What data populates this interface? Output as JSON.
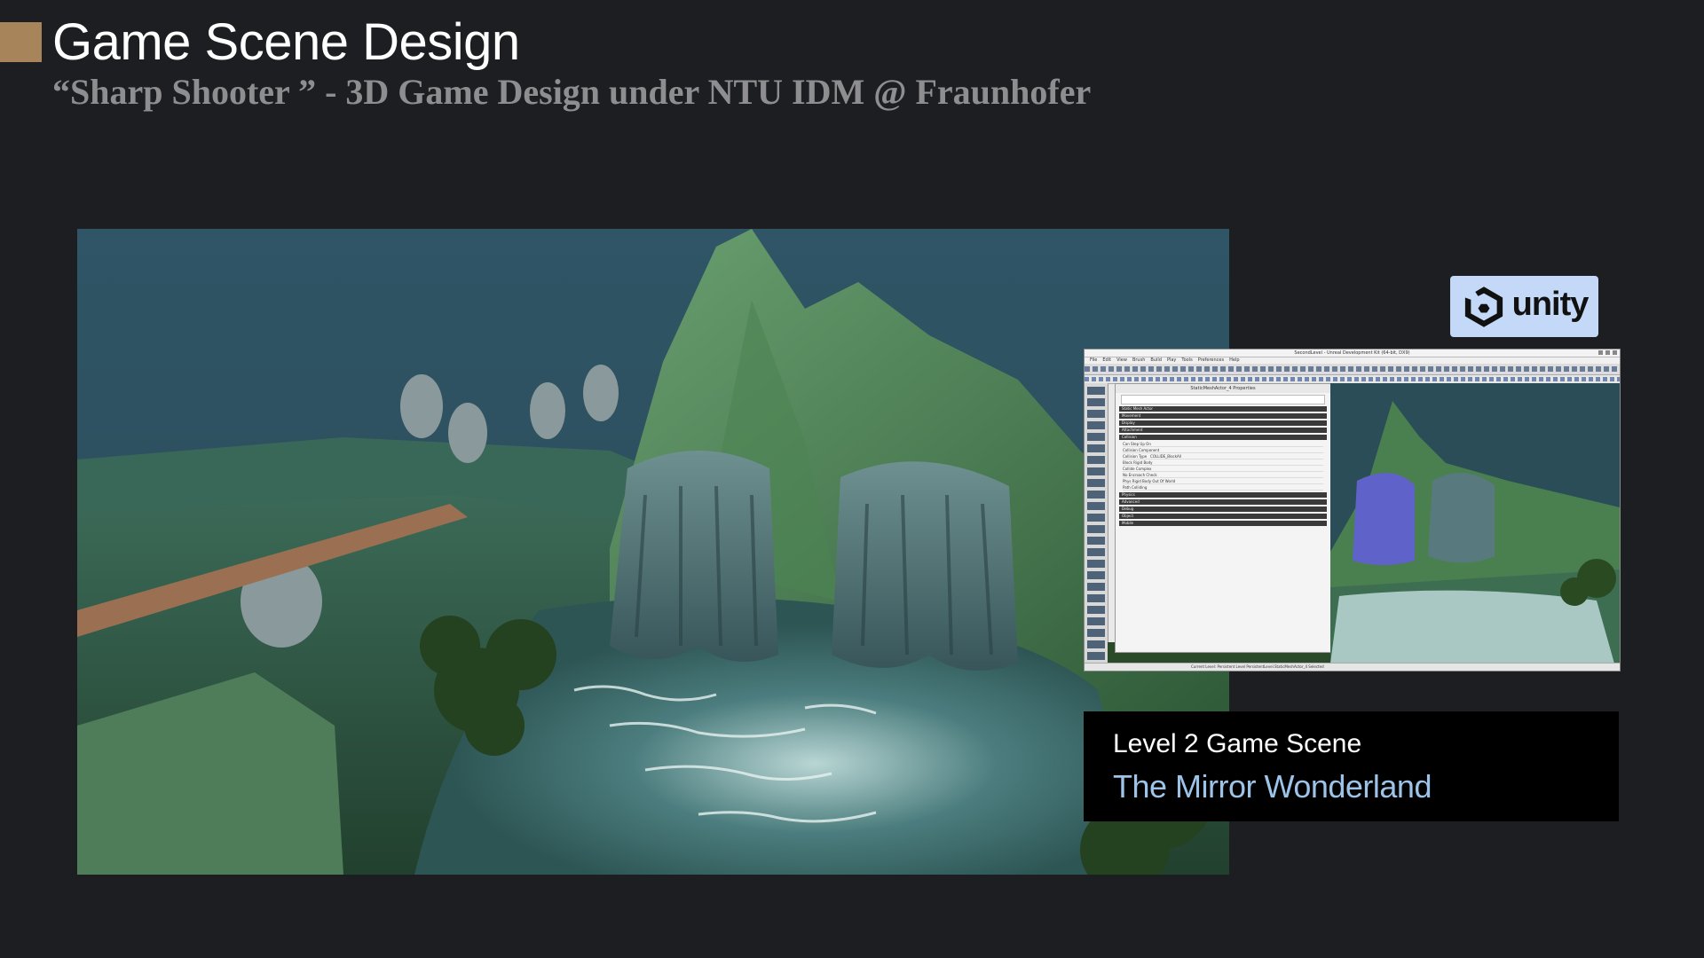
{
  "slide": {
    "title": "Game Scene Design",
    "subtitle": "“Sharp Shooter ” - 3D Game Design under NTU IDM @ Fraunhofer",
    "accent_color": "#a8845a",
    "background_color": "#1d1e22"
  },
  "main_image": {
    "icon": "game-scene-screenshot"
  },
  "badge": {
    "text": "unity",
    "icon": "unity-logo-icon",
    "background": "#c4d9f7"
  },
  "editor": {
    "window_title": "SecondLevel - Unreal Development Kit (64-bit, DX9)",
    "menu": [
      "File",
      "Edit",
      "View",
      "Brush",
      "Build",
      "Play",
      "Tools",
      "Preferences",
      "Help"
    ],
    "panel_title": "StaticMeshActor_4 Properties",
    "sections": [
      "Static Mesh Actor",
      "Movement",
      "Display",
      "Attachment",
      "Collision"
    ],
    "collision_rows": [
      "Can Step Up On",
      "Collision Component",
      "Collision Type",
      "Block Rigid Body",
      "Collide Complex",
      "No Encroach Check",
      "Phys Rigid Body Out Of World",
      "Path Colliding"
    ],
    "collision_type_value": "COLLIDE_BlockAll",
    "sections_after": [
      "Physics",
      "Advanced",
      "Debug",
      "Object",
      "Mobile"
    ],
    "status": "Current Level: Persistent Level     PersistentLevel.StaticMeshActor_4 Selected"
  },
  "caption": {
    "label": "Level 2 Game Scene",
    "name": "The Mirror Wonderland",
    "name_color": "#9ec3e8"
  }
}
